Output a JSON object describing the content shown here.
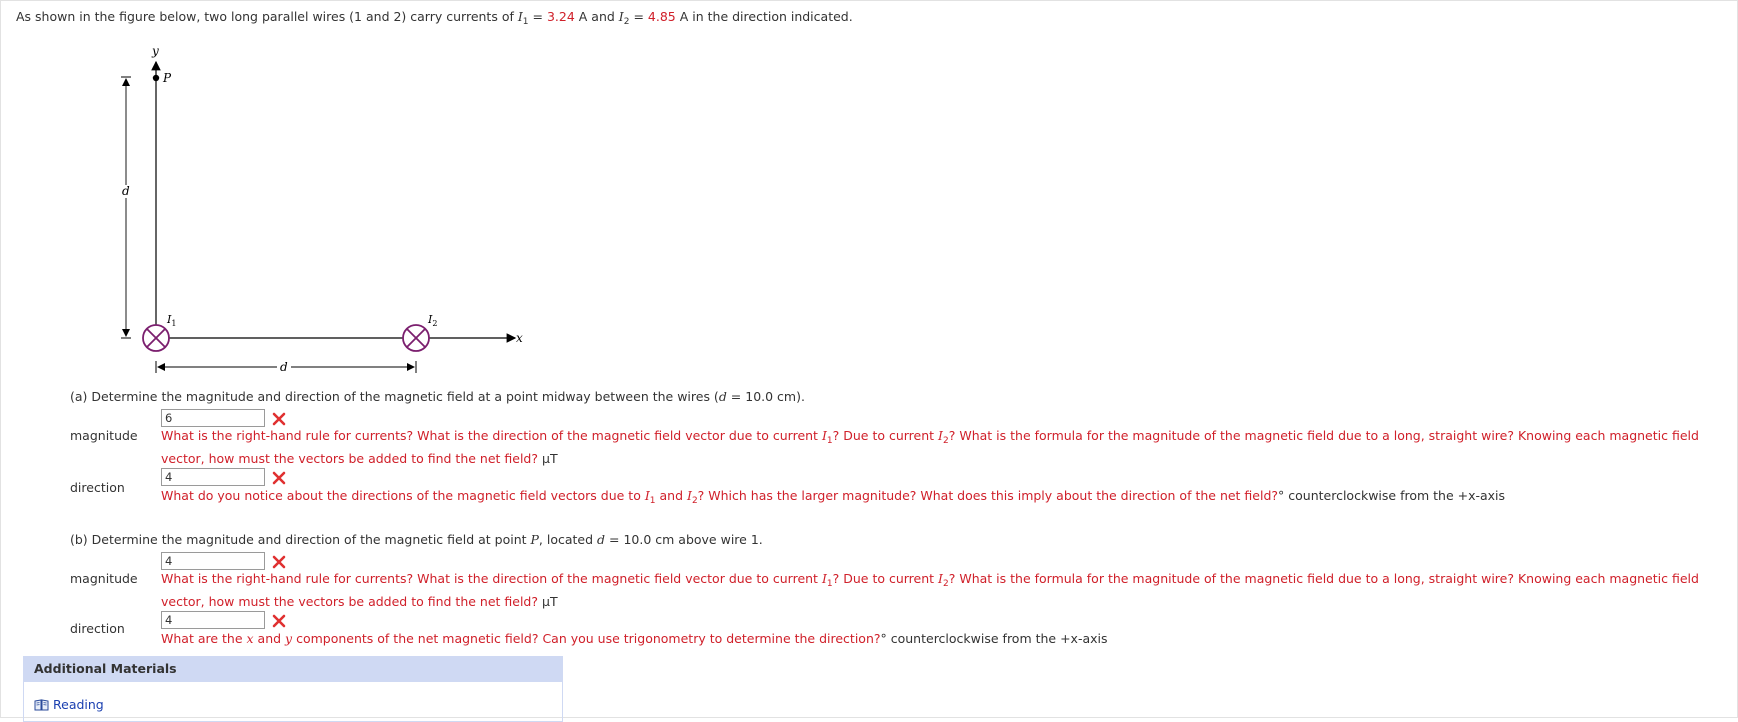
{
  "intro": {
    "prefix": "As shown in the figure below, two long parallel wires (1 and 2) carry currents of ",
    "I1_var": "I",
    "I1_sub": "1",
    "eq1": " = ",
    "I1_value": "3.24",
    "I1_unit": " A and ",
    "I2_var": "I",
    "I2_sub": "2",
    "eq2": " = ",
    "I2_value": "4.85",
    "suffix": " A in the direction indicated."
  },
  "figure": {
    "y_label": "y",
    "x_label": "x",
    "p_label": "P",
    "d_vertical": "d",
    "d_horizontal": "d",
    "wire1_label": "I",
    "wire1_sub": "1",
    "wire2_label": "I",
    "wire2_sub": "2",
    "wire_color": "#7b1f6e"
  },
  "part_a": {
    "question_pre": "(a) Determine the magnitude and direction of the magnetic field at a point midway between the wires (",
    "question_var": "d",
    "question_post": " = 10.0 cm).",
    "magnitude_label": "magnitude",
    "magnitude_value": "6",
    "magnitude_hint_1": "What is the right-hand rule for currents? What is the direction of the magnetic field vector due to current ",
    "magnitude_hint_2": "? Due to current ",
    "magnitude_hint_3": "? What is the formula for the magnitude of the magnetic field due to a long, straight wire? Knowing each magnetic field vector, how must the vectors be added to find the net field?",
    "magnitude_unit": " µT",
    "direction_label": "direction",
    "direction_value": "4",
    "direction_hint_1": "What do you notice about the directions of the magnetic field vectors due to ",
    "direction_hint_2": " and ",
    "direction_hint_3": "? Which has the larger magnitude? What does this imply about the direction of the net field?",
    "direction_unit": "° counterclockwise from the +x-axis"
  },
  "part_b": {
    "question_pre": "(b) Determine the magnitude and direction of the magnetic field at point ",
    "question_p": "P",
    "question_mid": ", located ",
    "question_var": "d",
    "question_post": " = 10.0 cm above wire 1.",
    "magnitude_label": "magnitude",
    "magnitude_value": "4",
    "magnitude_hint_1": "What is the right-hand rule for currents? What is the direction of the magnetic field vector due to current ",
    "magnitude_hint_2": "? Due to current ",
    "magnitude_hint_3": "? What is the formula for the magnitude of the magnetic field due to a long, straight wire? Knowing each magnetic field vector, how must the vectors be added to find the net field?",
    "magnitude_unit": " µT",
    "direction_label": "direction",
    "direction_value": "4",
    "direction_hint_1": "What are the ",
    "direction_hint_x": "x",
    "direction_hint_2": " and ",
    "direction_hint_y": "y",
    "direction_hint_3": " components of the net magnetic field? Can you use trigonometry to determine the direction?",
    "direction_unit": "° counterclockwise from the +x-axis"
  },
  "additional": {
    "title": "Additional Materials",
    "reading": "Reading"
  },
  "colors": {
    "red": "#d0202a",
    "link": "#1a3fb0",
    "panel": "#cfd9f3"
  }
}
